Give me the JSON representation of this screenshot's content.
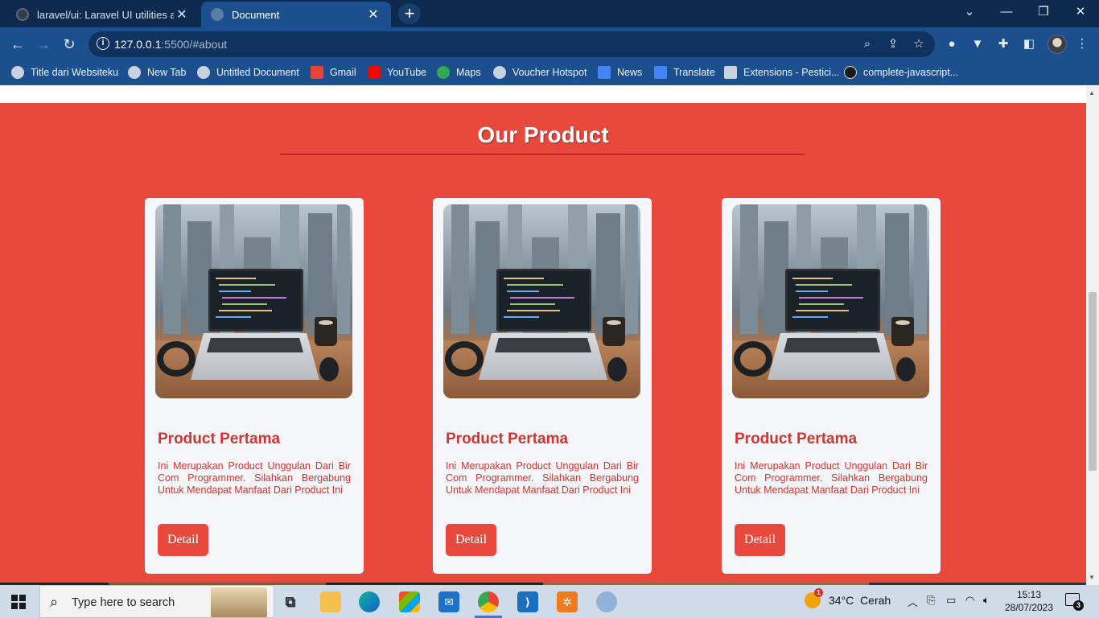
{
  "browser": {
    "tabs": [
      {
        "title": "laravel/ui: Laravel UI utilities and",
        "active": false,
        "favicon": "github-icon"
      },
      {
        "title": "Document",
        "active": true,
        "favicon": "globe-icon"
      }
    ],
    "new_tab": "+",
    "window_controls": {
      "tab_search": "⌄",
      "minimize": "—",
      "restore": "❐",
      "close": "✕"
    },
    "url": {
      "host": "127.0.0.1",
      "rest": ":5500/#about"
    },
    "bookmarks": [
      {
        "label": "Title dari Websiteku",
        "icon": "globe-icon",
        "color": "#c9d3df"
      },
      {
        "label": "New Tab",
        "icon": "globe-icon",
        "color": "#c9d3df"
      },
      {
        "label": "Untitled Document",
        "icon": "globe-icon",
        "color": "#c9d3df"
      },
      {
        "label": "Gmail",
        "icon": "gmail-icon",
        "color": "#ea4335"
      },
      {
        "label": "YouTube",
        "icon": "youtube-icon",
        "color": "#ff0000"
      },
      {
        "label": "Maps",
        "icon": "maps-icon",
        "color": "#34a853"
      },
      {
        "label": "Voucher Hotspot",
        "icon": "globe-icon",
        "color": "#c9d3df"
      },
      {
        "label": "News",
        "icon": "google-news-icon",
        "color": "#4285f4"
      },
      {
        "label": "Translate",
        "icon": "google-translate-icon",
        "color": "#4285f4"
      },
      {
        "label": "Extensions - Pestici...",
        "icon": "puzzle-icon",
        "color": "#c9d3df"
      },
      {
        "label": "complete-javascript...",
        "icon": "github-icon",
        "color": "#1a1a1a"
      }
    ]
  },
  "page": {
    "section_title": "Our Product",
    "colors": {
      "section_bg": "#e8493c",
      "card_bg": "#f4f6f9",
      "accent_text": "#d0352e",
      "button_bg": "#e8493c"
    },
    "products": [
      {
        "name": "Product Pertama",
        "description": "Ini Merupakan Product Unggulan Dari Bir Com Programmer. Silahkan Bergabung Untuk Mendapat Manfaat Dari Product Ini",
        "button": "Detail"
      },
      {
        "name": "Product Pertama",
        "description": "Ini Merupakan Product Unggulan Dari Bir Com Programmer. Silahkan Bergabung Untuk Mendapat Manfaat Dari Product Ini",
        "button": "Detail"
      },
      {
        "name": "Product Pertama",
        "description": "Ini Merupakan Product Unggulan Dari Bir Com Programmer. Silahkan Bergabung Untuk Mendapat Manfaat Dari Product Ini",
        "button": "Detail"
      }
    ]
  },
  "taskbar": {
    "search_placeholder": "Type here to search",
    "weather": {
      "temp": "34°C",
      "condition": "Cerah",
      "badge": "1"
    },
    "time": "15:13",
    "date": "28/07/2023",
    "notification_count": "3"
  }
}
